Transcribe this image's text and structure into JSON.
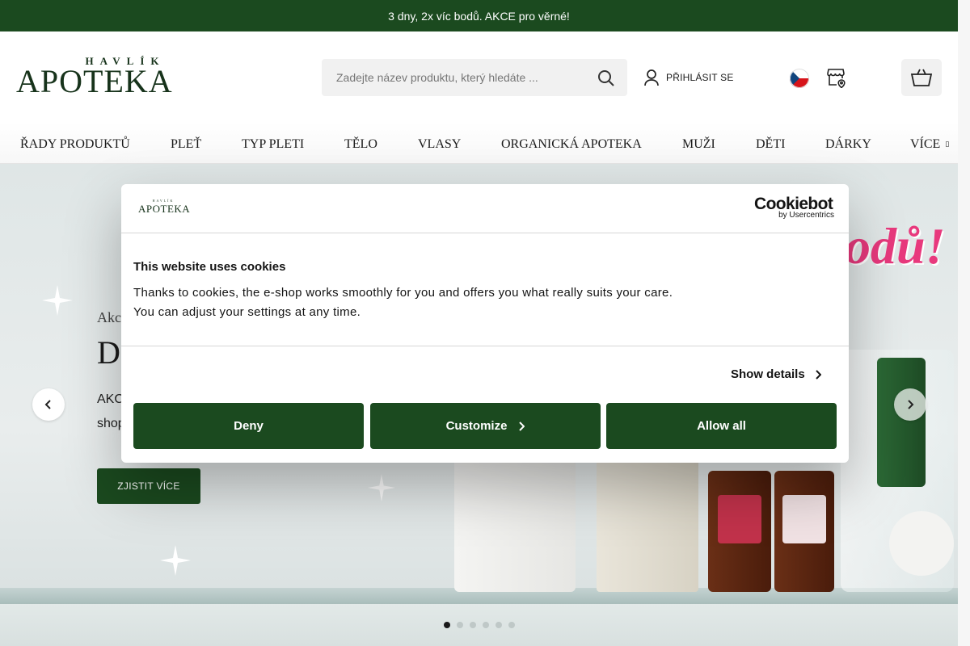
{
  "promo": {
    "text": "3 dny, 2x víc bodů.  AKCE pro věrné!"
  },
  "logo": {
    "sub": "HAVLÍK",
    "main": "APOTEKA"
  },
  "search": {
    "placeholder": "Zadejte název produktu, který hledáte ..."
  },
  "header": {
    "login_label": "PŘIHLÁSIT SE"
  },
  "nav": {
    "items": [
      {
        "label": "ŘADY PRODUKTŮ"
      },
      {
        "label": "PLEŤ"
      },
      {
        "label": "TYP PLETI"
      },
      {
        "label": "TĚLO"
      },
      {
        "label": "VLASY"
      },
      {
        "label": "ORGANICKÁ APOTEKA"
      },
      {
        "label": "MUŽI"
      },
      {
        "label": "DĚTI"
      },
      {
        "label": "DÁRKY"
      },
      {
        "label": "VÍCE"
      }
    ]
  },
  "hero": {
    "tag": "Akc",
    "headline": "D",
    "text1": "AKC",
    "text2": "shop",
    "cta_label": "ZJISTIT VÍCE",
    "banner_text": "odů!",
    "slide_count": 6,
    "active_slide": 1
  },
  "cookie": {
    "logo_sub": "HAVLÍK",
    "logo_main": "APOTEKA",
    "brand": "Cookiebot",
    "brand_sub": "by Usercentrics",
    "title": "This website uses cookies",
    "text1": "Thanks to cookies, the e-shop works smoothly for you and offers you what really suits your care.",
    "text2": "You can adjust your settings at any time.",
    "show_details": "Show details",
    "deny": "Deny",
    "customize": "Customize",
    "allow_all": "Allow all"
  },
  "colors": {
    "brand_green": "#1b4a1f",
    "logo_green": "#17331b"
  }
}
